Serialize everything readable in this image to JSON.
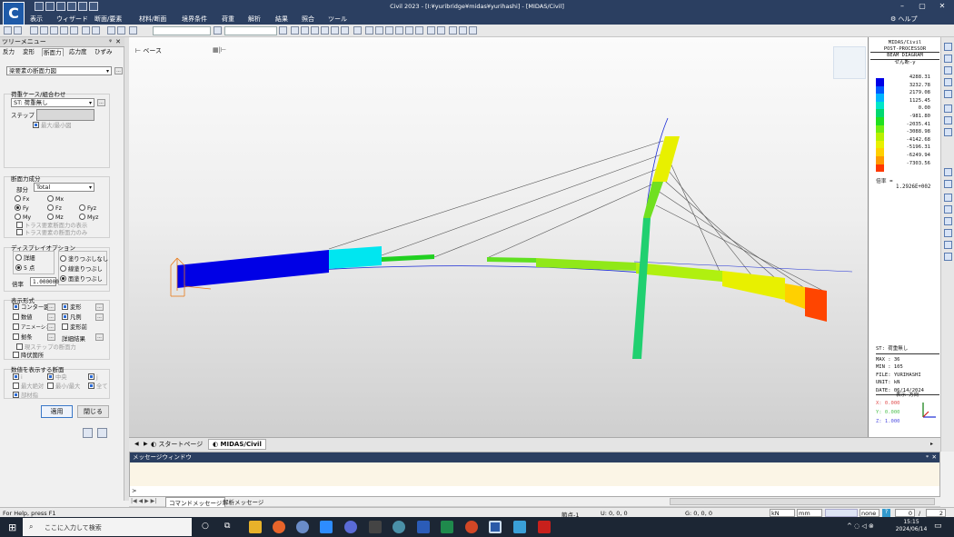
{
  "titlebar": {
    "title": "Civil 2023 - [I:¥yuribridge¥midas¥yurihashi] - [MIDAS/Civil]",
    "logo_letter": "C"
  },
  "menu": [
    "表示",
    "ウィザード",
    "断面/要素",
    "材料/断面",
    "境界条件",
    "荷重",
    "解析",
    "結果",
    "照合",
    "ツール"
  ],
  "menu_help": "ヘルプ",
  "tree": {
    "header": "ツリーメニュー",
    "tabs": [
      "反力",
      "変形",
      "断面力",
      "応力度",
      "ひずみ"
    ],
    "active_tab": "断面力",
    "diagram_select": "梁要素の断面力図",
    "loadcase": {
      "title": "荷重ケース/組合わせ",
      "value": "ST: 荷重無し",
      "step_label": "ステップ",
      "minmax": "最大/最小図"
    },
    "force": {
      "title": "断面力成分",
      "part_label": "部分",
      "part_value": "Total",
      "radios": [
        "Fx",
        "Mx",
        "Fy",
        "Fz",
        "Fyz",
        "My",
        "Mz",
        "Myz"
      ],
      "selected": "Fy",
      "truss1": "トラス要素断面力の表示",
      "truss2": "トラス要素の断面力のみ"
    },
    "display_opt": {
      "title": "ディスプレイオプション",
      "detail": "詳細",
      "points": "5 点",
      "no_fill": "塗りつぶしなし",
      "line_fill": "線塗りつぶし",
      "solid_fill": "面塗りつぶし",
      "scale_label": "倍率",
      "scale": "1.000000"
    },
    "display_type": {
      "title": "表示形式",
      "items": [
        {
          "label": "コンター図",
          "checked": true
        },
        {
          "label": "変形",
          "checked": true
        },
        {
          "label": "数値",
          "checked": false
        },
        {
          "label": "凡例",
          "checked": true
        },
        {
          "label": "アニメーション",
          "checked": false
        },
        {
          "label": "変形前",
          "checked": false
        },
        {
          "label": "拠条",
          "checked": false
        },
        {
          "label": "詳細結果",
          "checked": false
        }
      ],
      "cur_step": "現ステップの断面力",
      "yield": "降伏箇所"
    },
    "show_values": {
      "title": "数値を表示する断面",
      "i": "i",
      "center": "中央",
      "j": "j",
      "max_abs": "最大絶対",
      "min_max": "最小/最大",
      "all": "全て",
      "element": "部材指"
    },
    "apply": "適用",
    "close": "閉じる"
  },
  "view": {
    "base_label": "ベース",
    "tabs": [
      "スタートページ",
      "MIDAS/Civil"
    ]
  },
  "legend": {
    "lines": [
      "MIDAS/Civil",
      "POST-PROCESSOR",
      "BEAM DIAGRAM",
      "せん断-y"
    ],
    "values": [
      "4288.31",
      "3232.78",
      "2179.08",
      "1125.45",
      "0.00",
      "-981.80",
      "-2035.41",
      "-3088.98",
      "-4142.68",
      "-5196.31",
      "-6249.94",
      "-7303.56"
    ],
    "colors": [
      "#0000e6",
      "#0058ff",
      "#00b4ff",
      "#00e6c8",
      "#00d870",
      "#20e020",
      "#70ee10",
      "#b8f000",
      "#e8f000",
      "#ffd000",
      "#ff9a00",
      "#ff3800"
    ],
    "scale_label": "倍率 =",
    "scale_value": "1.2926E+002",
    "info": [
      "ST: 荷重無し",
      "MAX : 36",
      "MIN : 105",
      "FILE: YURIHASHI",
      "UNIT: kN",
      "DATE: 06/14/2024"
    ],
    "dir_label": "表示-方向",
    "dir": [
      "X: 0.000",
      "Y: 0.000",
      "Z: 1.000"
    ]
  },
  "messages": {
    "header": "メッセージウィンドウ",
    "prompt": ">",
    "tabs": [
      "コマンドメッセージ",
      "解析メッセージ"
    ]
  },
  "status": {
    "help": "For Help, press F1",
    "node": "節点-1",
    "u": "U: 0, 0, 0",
    "g": "G: 0, 0, 0",
    "unit_force": "kN",
    "unit_len": "mm",
    "none": "none",
    "page": "0",
    "page_total": "2"
  },
  "taskbar": {
    "search": "ここに入力して検索",
    "time": "15:15",
    "date": "2024/06/14"
  }
}
